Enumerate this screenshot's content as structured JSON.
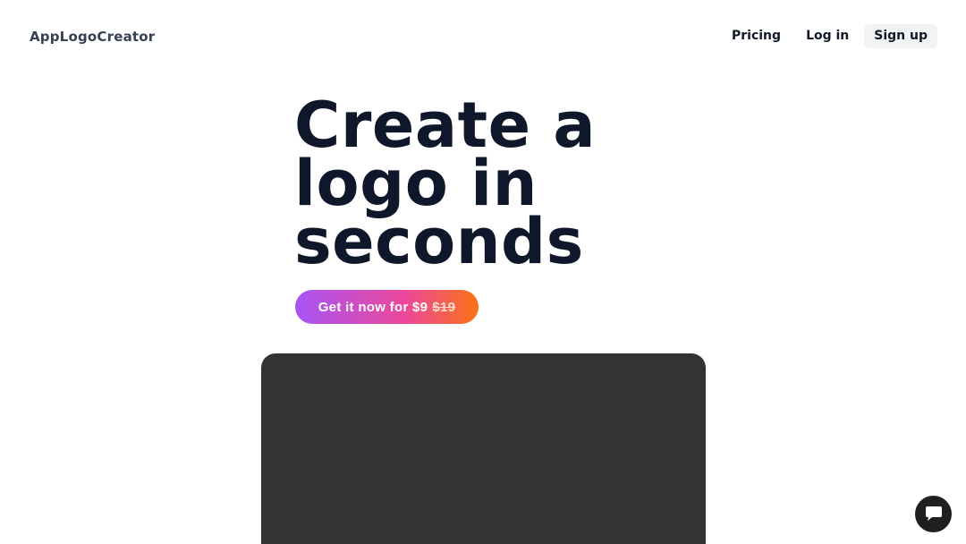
{
  "header": {
    "brand": "AppLogoCreator",
    "nav": {
      "pricing": "Pricing",
      "login": "Log in",
      "signup": "Sign up"
    }
  },
  "hero": {
    "title_line1": "Create a",
    "title_line2": "logo in",
    "title_line3": "seconds",
    "cta_label": "Get it now for $9",
    "cta_old_price": "$19"
  },
  "chat": {
    "icon": "chat-bubble-icon"
  },
  "colors": {
    "cta_gradient_start": "#a855f7",
    "cta_gradient_mid": "#ec4899",
    "cta_gradient_end": "#f97316",
    "video_panel": "#333333",
    "chat_button": "#1f1f1f"
  }
}
